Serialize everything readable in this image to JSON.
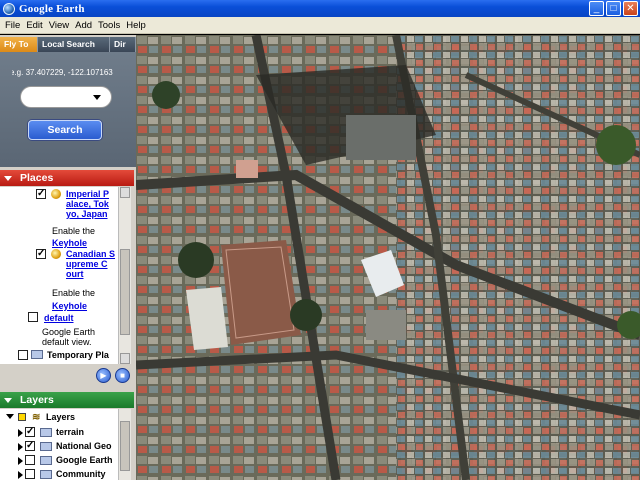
{
  "window": {
    "title": "Google Earth"
  },
  "menu": [
    "File",
    "Edit",
    "View",
    "Add",
    "Tools",
    "Help"
  ],
  "menu_underline": [
    "F",
    "E",
    "V",
    "A",
    "T",
    "H"
  ],
  "tabs": {
    "flyto": "Fly To",
    "local": "Local Search",
    "dir": "Dir"
  },
  "flyto": {
    "hint": "e.g. 37.407229, -122.107163",
    "search_label": "Search"
  },
  "places": {
    "header": "Places",
    "imperial": {
      "name": "Imperial Palace, Tokyo, Japan",
      "lines": [
        "Imperial P",
        "alace, Tok",
        "yo, Japan"
      ]
    },
    "enable_text": "Enable the",
    "keyhole_lines": [
      "Keyhole"
    ],
    "canadian": {
      "lines": [
        "Canadian S",
        "upreme C",
        "ourt"
      ]
    },
    "default_label": "default",
    "default_desc": [
      "Google Earth",
      "default view."
    ],
    "temporary": "Temporary Pla"
  },
  "layers": {
    "header": "Layers",
    "root": "Layers",
    "items": [
      "terrain",
      "National Geo",
      "Google Earth",
      "Community"
    ]
  },
  "colors": {
    "places_header": "#c8221a",
    "layers_header": "#2a8a3a",
    "tab_active": "#e8a030",
    "title_bar": "#0a4fd8"
  }
}
